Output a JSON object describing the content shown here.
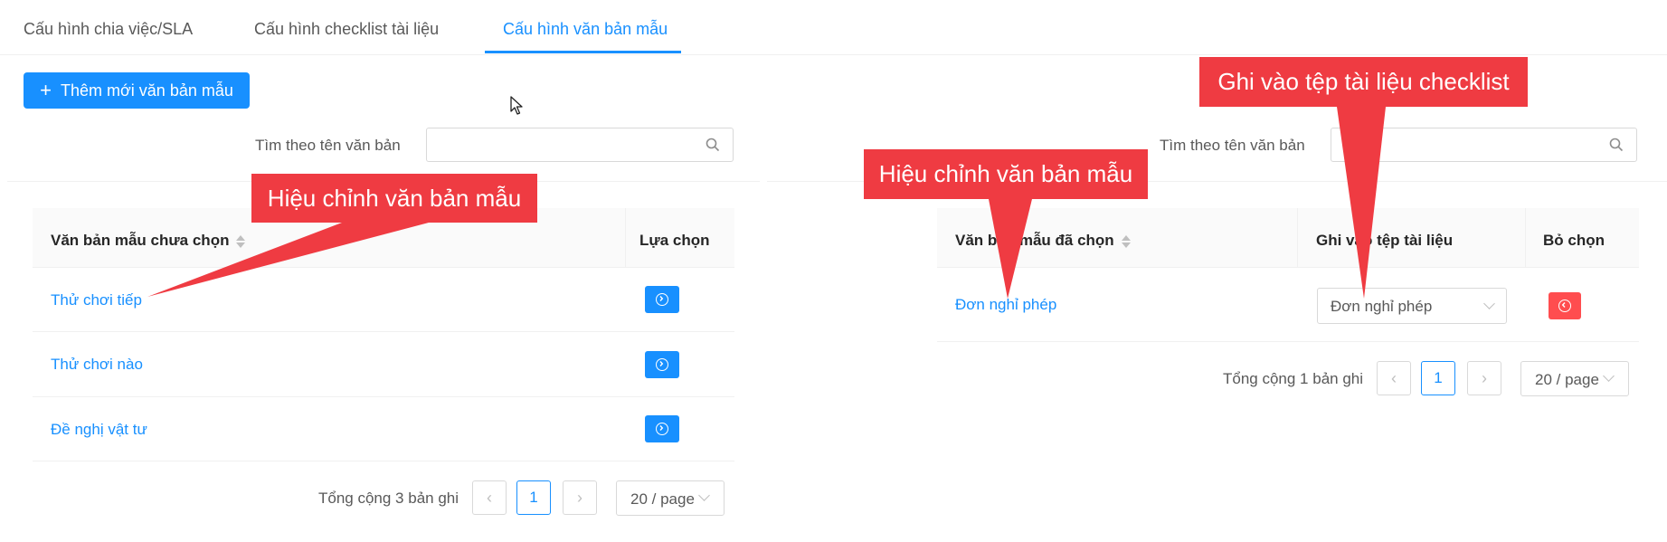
{
  "tabs": [
    {
      "label": "Cấu hình chia việc/SLA",
      "active": false
    },
    {
      "label": "Cấu hình checklist tài liệu",
      "active": false
    },
    {
      "label": "Cấu hình văn bản mẫu",
      "active": true
    }
  ],
  "add_button": {
    "label": "Thêm mới văn bản mẫu",
    "icon": "plus-icon"
  },
  "left_panel": {
    "search_label": "Tìm theo tên văn bản",
    "search_value": "",
    "columns": [
      "Văn bản mẫu chưa chọn",
      "Lựa chọn"
    ],
    "rows": [
      {
        "name": "Thử chơi tiếp"
      },
      {
        "name": "Thử chơi nào"
      },
      {
        "name": "Đề nghị vật tư"
      }
    ],
    "pagination": {
      "total": "Tổng cộng 3 bản ghi",
      "page": "1",
      "page_size": "20 / page"
    }
  },
  "right_panel": {
    "search_label": "Tìm theo tên văn bản",
    "search_value": "",
    "columns": [
      "Văn bản mẫu đã chọn",
      "Ghi vào tệp tài liệu",
      "Bỏ chọn"
    ],
    "rows": [
      {
        "name": "Đơn nghỉ phép",
        "file": "Đơn nghỉ phép"
      }
    ],
    "pagination": {
      "total": "Tổng cộng 1 bản ghi",
      "page": "1",
      "page_size": "20 / page"
    }
  },
  "callouts": {
    "left_edit": "Hiệu chỉnh văn bản mẫu",
    "right_edit": "Hiệu chỉnh văn bản mẫu",
    "checklist": "Ghi vào tệp tài liệu checklist"
  },
  "colors": {
    "primary": "#1890ff",
    "danger": "#ff4d4f",
    "callout": "#ef3b42"
  }
}
